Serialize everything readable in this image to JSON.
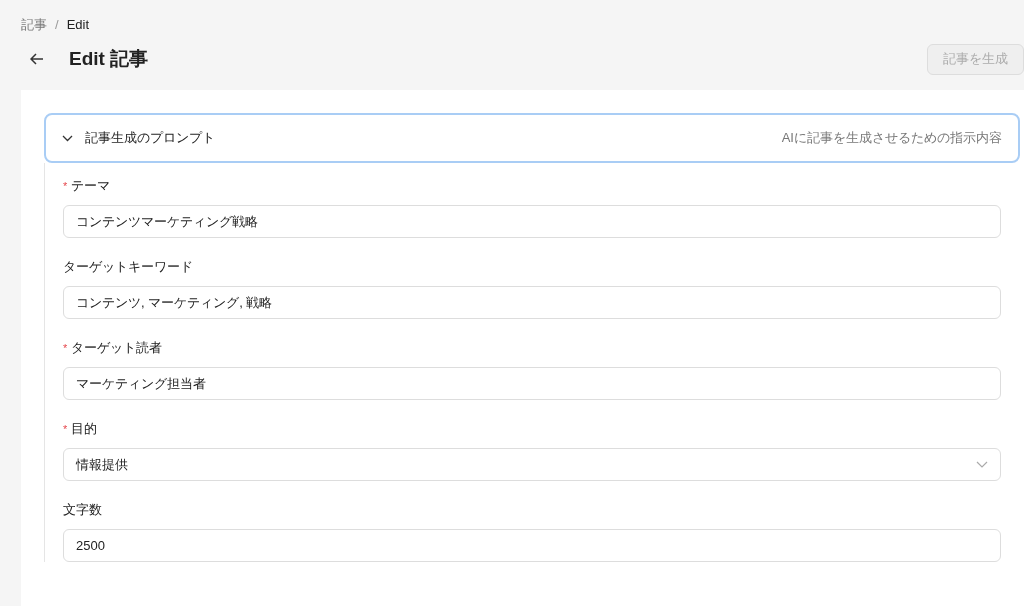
{
  "breadcrumb": {
    "items": [
      "記事",
      "Edit"
    ],
    "separators": [
      "/"
    ]
  },
  "title": "Edit 記事",
  "generate_button": {
    "label": "記事を生成",
    "disabled": true
  },
  "panel": {
    "title": "記事生成のプロンプト",
    "description": "AIに記事を生成させるための指示内容",
    "expanded": true
  },
  "fields": [
    {
      "kind": "text",
      "label": "テーマ",
      "required_mark": "*",
      "value": "コンテンツマーケティング戦略"
    },
    {
      "kind": "text",
      "label": "ターゲットキーワード",
      "value": "コンテンツ, マーケティング, 戦略"
    },
    {
      "kind": "text",
      "label": "ターゲット読者",
      "required_mark": "*",
      "value": "マーケティング担当者"
    },
    {
      "kind": "select",
      "label": "目的",
      "required_mark": "*",
      "value": "情報提供"
    },
    {
      "kind": "text",
      "label": "文字数",
      "value": "2500"
    }
  ]
}
